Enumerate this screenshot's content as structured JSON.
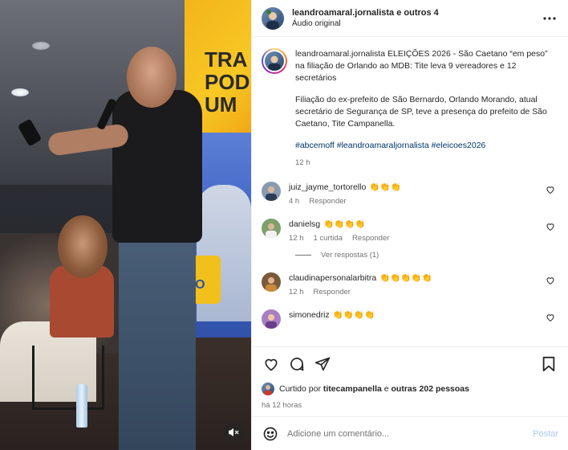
{
  "media": {
    "banner_text": "TRA\nPODE\nUM",
    "screen_text": "DO\nNDO",
    "mute_icon": "speaker-muted-icon"
  },
  "header": {
    "username": "leandroamaral.jornalista e outros 4",
    "audio": "Áudio original",
    "more_icon": "more-horizontal-icon"
  },
  "caption": {
    "username": "leandroamaral.jornalista",
    "text": "ELEIÇÕES 2026 - São Caetano “em peso” na filiação de Orlando ao MDB: Tite leva 9 vereadores e 12 secretários",
    "paragraph": "Filiação do ex-prefeito de São Bernardo, Orlando Morando, atual secretário de Segurança de SP, teve a presença do prefeito de São Caetano, Tite Campanella.",
    "hashtags": "#abcemoff #leandroamaraljornalista #eleicoes2026",
    "time": "12 h"
  },
  "comments": [
    {
      "user": "juiz_jayme_tortorello",
      "text": "👏👏👏",
      "time": "4 h",
      "likes": "",
      "reply": "Responder",
      "avatar_color": "#8a9bb0"
    },
    {
      "user": "danielsg",
      "text": "👏👏👏👏",
      "time": "12 h",
      "likes": "1 curtida",
      "reply": "Responder",
      "avatar_color": "#7ea06a",
      "view_replies": "Ver respostas (1)"
    },
    {
      "user": "claudinapersonalarbitra",
      "text": "👏👏👏👏👏",
      "time": "12 h",
      "likes": "",
      "reply": "Responder",
      "avatar_color": "#7a5a3a"
    },
    {
      "user": "simonedriz",
      "text": "👏👏👏👏",
      "time": "",
      "likes": "",
      "reply": "",
      "avatar_color": "#a77fc2"
    }
  ],
  "actions": {
    "like_icon": "heart-icon",
    "comment_icon": "comment-icon",
    "share_icon": "share-icon",
    "save_icon": "bookmark-icon"
  },
  "likes": {
    "prefix": "Curtido por",
    "user": "titecampanella",
    "middle": "e",
    "others": "outras 202 pessoas"
  },
  "posted": "há 12 horas",
  "add_comment": {
    "placeholder": "Adicione um comentário...",
    "post_label": "Postar"
  }
}
